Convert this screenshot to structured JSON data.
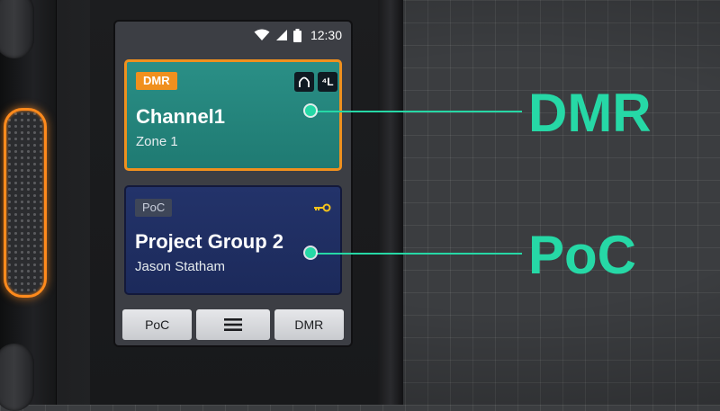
{
  "status_bar": {
    "time": "12:30",
    "icons": [
      "wifi-icon",
      "signal-icon",
      "battery-icon"
    ]
  },
  "dmr_card": {
    "badge": "DMR",
    "channel": "Channel1",
    "zone": "Zone 1",
    "icon_a_label": "⋀",
    "icon_b_label": "⁴L"
  },
  "poc_card": {
    "badge": "PoC",
    "group": "Project Group 2",
    "user": "Jason Statham",
    "icons": [
      "key-icon"
    ]
  },
  "softkeys": {
    "left": "PoC",
    "middle": "menu-icon",
    "right": "DMR"
  },
  "callouts": {
    "dmr": "DMR",
    "poc": "PoC"
  },
  "colors": {
    "accent_green": "#26d8a6",
    "dmr_orange": "#f0901e",
    "dmr_card": "#1f7a72",
    "poc_card": "#1c2a5b"
  }
}
